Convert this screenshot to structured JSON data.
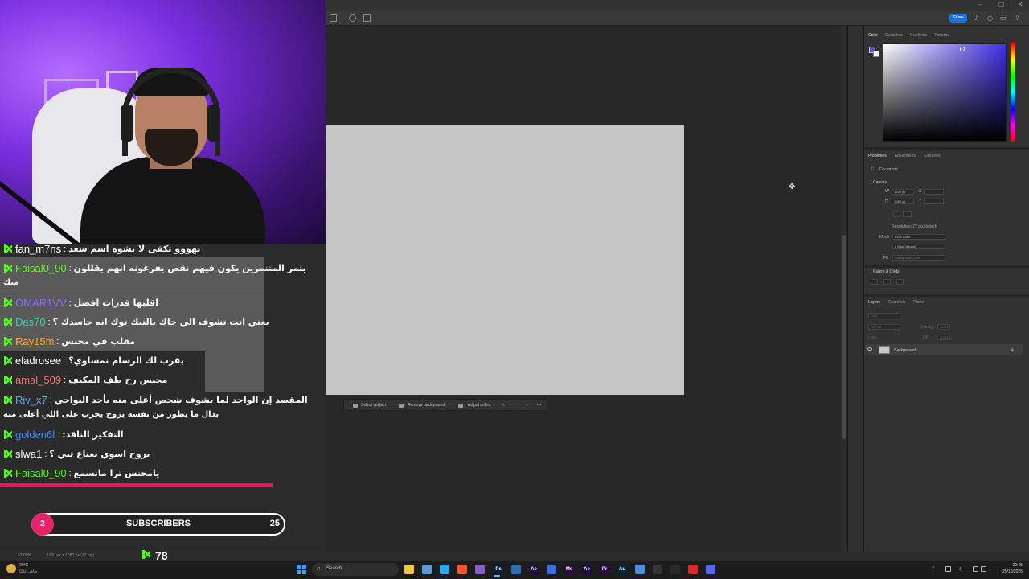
{
  "photoshop": {
    "share_label": "Share",
    "zoom": "62.09%",
    "doc_size": "1920 px x 1080 px (72 ppi)",
    "color_tabs": [
      "Color",
      "Swatches",
      "Gradients",
      "Patterns"
    ],
    "properties_tabs": [
      "Properties",
      "Adjustments",
      "Libraries"
    ],
    "properties": {
      "document_label": "Document",
      "canvas_label": "Canvas",
      "width": "1920 px",
      "height": "1080 px",
      "x_label": "X",
      "y_label": "Y",
      "resolution": "Resolution: 72 pixels/inch",
      "mode_label": "Mode",
      "mode_value": "RGB Color",
      "bit_depth": "8 Bits/Channel",
      "fill_label": "Fill",
      "fill_value": "Background Color",
      "rulers_label": "Rulers & Grids"
    },
    "layers_tabs": [
      "Layers",
      "Channels",
      "Paths"
    ],
    "layers": {
      "kind_label": "Kind",
      "blend_mode": "Normal",
      "opacity_label": "Opacity:",
      "opacity_value": "100%",
      "lock_label": "Lock:",
      "fill_label": "Fill:",
      "fill_value": "100%",
      "layer_name": "Background"
    },
    "context_bar": {
      "select_subject": "Select subject",
      "remove_background": "Remove background",
      "adjust_colors": "Adjust colors"
    }
  },
  "chat": {
    "messages": [
      {
        "user": "fan_m7ns",
        "color": "#ffffff",
        "text": "يهووو تكفى لا تشوه اسم سعد"
      },
      {
        "user": "Faisal0_90",
        "color": "#53fc18",
        "text": "بتمر المتنمرين يكون فيهم نقص يفرغونه انهم يقللون",
        "cont": "منك"
      },
      {
        "user": "OMAR1VV",
        "color": "#8e6bff",
        "text": "اقلبها قدرات افضل"
      },
      {
        "user": "Das70",
        "color": "#2fd0b4",
        "text": "يعني انت تشوف الي جاك بالتيك توك انه حاسدك ؟"
      },
      {
        "user": "Ray15m",
        "color": "#f5a623",
        "text": "مقلب في محنس"
      },
      {
        "user": "eladrosee",
        "color": "#ffffff",
        "text": "يقرب لك الرسام نمساوي؟"
      },
      {
        "user": "amal_509",
        "color": "#ff6b6b",
        "text": "محنس رح طف المكيف"
      },
      {
        "user": "Riv_x7",
        "color": "#5ba3ff",
        "text": "المقصد إن الواحد لما يشوف شخص أعلى منه بأحد النواحي",
        "cont": "بدال ما يطور من نفسه يروح يخرب على اللي أعلى منه"
      },
      {
        "user": "golden6l",
        "color": "#3d8bff",
        "text": ":التفكير الناقد"
      },
      {
        "user": "slwa1",
        "color": "#ffffff",
        "text": "بروح اسوي نعناع تبي ؟"
      },
      {
        "user": "Faisal0_90",
        "color": "#53fc18",
        "text": "يامحنس ترا مانسمع"
      }
    ]
  },
  "subscribers": {
    "current": "2",
    "label": "SUBSCRIBERS",
    "goal": "25"
  },
  "viewers": "78",
  "taskbar": {
    "weather_temp": "29°C",
    "weather_desc": "صافي غالبًا",
    "search_placeholder": "Search",
    "time": "20:45",
    "date": "29/10/2025",
    "apps": [
      {
        "name": "file-explorer",
        "color": "#f4c542",
        "glyph": ""
      },
      {
        "name": "store",
        "color": "#5a9bd5",
        "glyph": ""
      },
      {
        "name": "vscode",
        "color": "#23a9f2",
        "glyph": ""
      },
      {
        "name": "brave",
        "color": "#fb542b",
        "glyph": ""
      },
      {
        "name": "visual-studio",
        "color": "#8661c5",
        "glyph": ""
      },
      {
        "name": "photoshop",
        "color": "#001e36",
        "glyph": "Ps"
      },
      {
        "name": "blender",
        "color": "#2f6db5",
        "glyph": ""
      },
      {
        "name": "after-effects",
        "color": "#1f0740",
        "glyph": "Ae"
      },
      {
        "name": "media-app",
        "color": "#3a6fd8",
        "glyph": ""
      },
      {
        "name": "media-encoder",
        "color": "#2a0a40",
        "glyph": "Me"
      },
      {
        "name": "animate",
        "color": "#1f0740",
        "glyph": "Ae"
      },
      {
        "name": "premiere",
        "color": "#2a0a40",
        "glyph": "Pr"
      },
      {
        "name": "audition",
        "color": "#00263e",
        "glyph": "Au"
      },
      {
        "name": "app-generic",
        "color": "#4a8fe0",
        "glyph": ""
      },
      {
        "name": "app-dark",
        "color": "#333333",
        "glyph": ""
      },
      {
        "name": "obs",
        "color": "#2a2a2a",
        "glyph": ""
      },
      {
        "name": "opera",
        "color": "#e0262b",
        "glyph": ""
      },
      {
        "name": "discord",
        "color": "#5865f2",
        "glyph": ""
      }
    ]
  }
}
